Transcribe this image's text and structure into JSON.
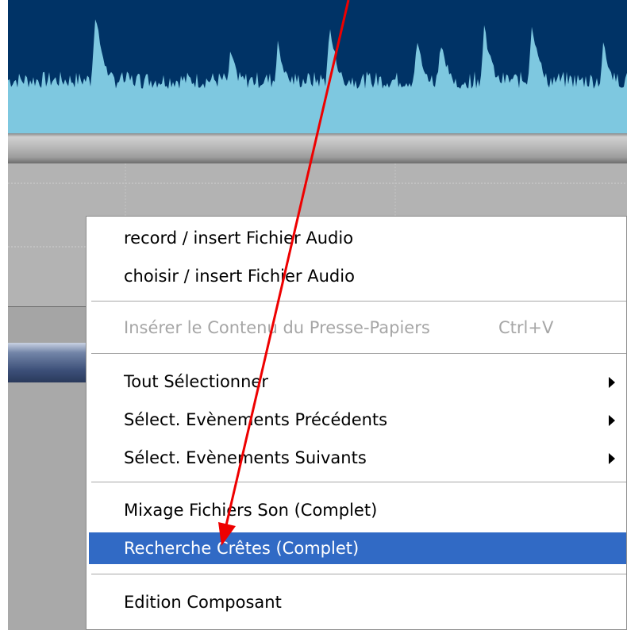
{
  "context_menu": {
    "items": [
      {
        "label": "record / insert Fichier Audio"
      },
      {
        "label": "choisir / insert Fichier Audio"
      },
      {
        "label": "Insérer le Contenu du Presse-Papiers",
        "shortcut": "Ctrl+V",
        "disabled": true
      },
      {
        "label": "Tout Sélectionner",
        "submenu": true
      },
      {
        "label": "Sélect. Evènements Précédents",
        "submenu": true
      },
      {
        "label": "Sélect. Evènements Suivants",
        "submenu": true
      },
      {
        "label": "Mixage Fichiers Son (Complet)"
      },
      {
        "label": "Recherche Crêtes (Complet)",
        "highlighted": true
      },
      {
        "label": "Edition Composant"
      }
    ]
  },
  "colors": {
    "waveform_background": "#003366",
    "waveform_fill": "#7ec8e0",
    "menu_highlight": "#316ac5",
    "annotation_arrow": "#ff0000"
  },
  "icons": [
    "submenu-arrow-icon",
    "annotation-arrow-icon"
  ]
}
